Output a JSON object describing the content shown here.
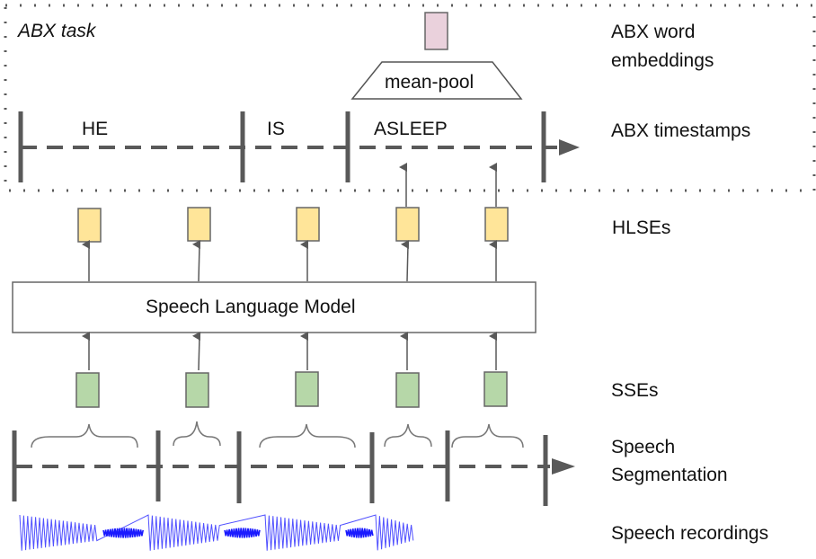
{
  "abx_box": {
    "title": "ABX task"
  },
  "right_labels": {
    "abx_word_embeddings": [
      "ABX word",
      "embeddings"
    ],
    "abx_timestamps": "ABX timestamps",
    "hlses": "HLSEs",
    "sses": "SSEs",
    "speech_segmentation": [
      "Speech",
      "Segmentation"
    ],
    "speech_recordings": "Speech recordings"
  },
  "pooling": {
    "label": "mean-pool"
  },
  "model": {
    "label": "Speech Language Model"
  },
  "words": [
    "HE",
    "IS",
    "ASLEEP"
  ],
  "colors": {
    "word_embedding": "#ead1dc",
    "hlse": "#ffe599",
    "sse": "#b6d7a8",
    "line": "#595959",
    "waveform": "#1a1aff"
  },
  "counts": {
    "hlses": 5,
    "sses": 5,
    "segments": 5
  }
}
